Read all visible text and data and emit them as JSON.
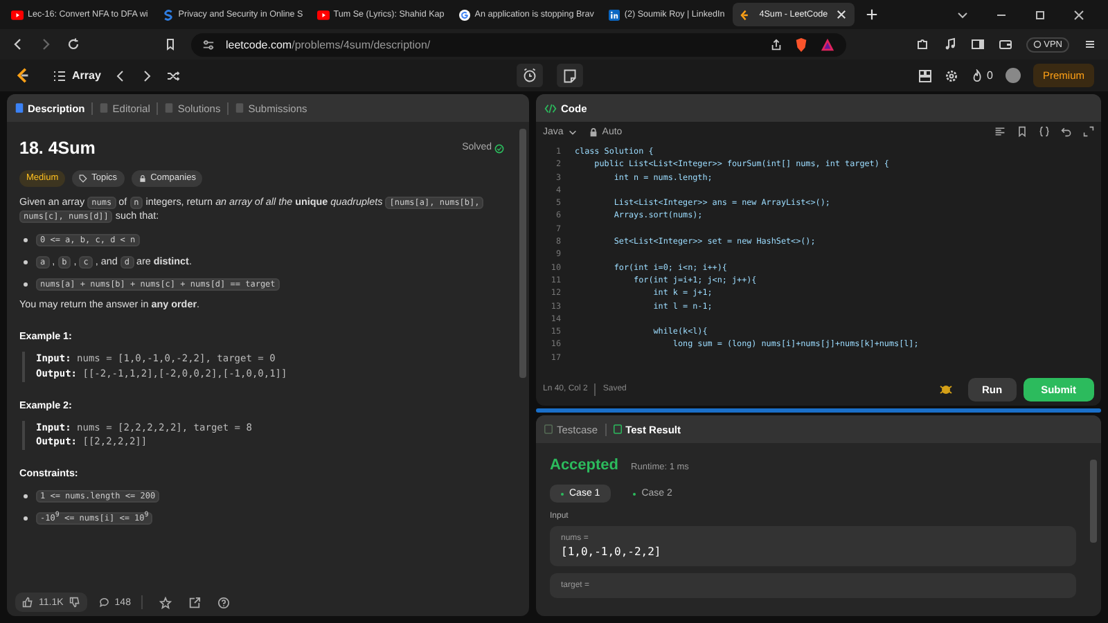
{
  "browser": {
    "tabs": [
      {
        "title": "Lec-16: Convert NFA to DFA wi",
        "kind": "video",
        "selected": false
      },
      {
        "title": "Privacy and Security in Online S",
        "kind": "letter",
        "selected": false
      },
      {
        "title": "Tum Se (Lyrics): Shahid Kap",
        "kind": "video",
        "selected": false
      },
      {
        "title": "An application is stopping Brav",
        "kind": "globe",
        "selected": false
      },
      {
        "title": "(2) Soumik Roy | LinkedIn",
        "kind": "square",
        "selected": false
      },
      {
        "title": "4Sum - LeetCode",
        "kind": "brand",
        "selected": true
      }
    ],
    "address": {
      "host": "leetcode.com",
      "path": "/problems/4sum/description/"
    },
    "vpn": "VPN"
  },
  "navbar": {
    "problem_list": "Array",
    "streak": "0",
    "premium": "Premium"
  },
  "description": {
    "tabs": [
      {
        "label": "Description",
        "selected": true
      },
      {
        "label": "Editorial",
        "selected": false
      },
      {
        "label": "Solutions",
        "selected": false
      },
      {
        "label": "Submissions",
        "selected": false
      }
    ],
    "title": "18. 4Sum",
    "status": "Solved",
    "tags": [
      {
        "label": "Medium",
        "kind": "difficulty"
      },
      {
        "label": "Topics",
        "kind": "topics"
      },
      {
        "label": "Companies",
        "kind": "companies"
      }
    ],
    "blocks": [
      {
        "kind": "paragraph",
        "segments": [
          {
            "kind": "text",
            "text": "Given an array"
          },
          {
            "kind": "code",
            "text": "nums"
          },
          {
            "kind": "text",
            "text": "of"
          },
          {
            "kind": "code",
            "text": "n"
          },
          {
            "kind": "text",
            "text": "integers, return *an array of all the* **unique** *quadruplets*"
          },
          {
            "kind": "code",
            "text": "[nums[a], nums[b],"
          },
          {
            "kind": "code",
            "text": "nums[c], nums[d]]"
          },
          {
            "kind": "text",
            "text": "such that:"
          }
        ]
      },
      {
        "kind": "bullet",
        "segments": [
          {
            "kind": "code",
            "text": "0 <= a, b, c, d < n"
          }
        ]
      },
      {
        "kind": "bullet",
        "segments": [
          {
            "kind": "code",
            "text": "a"
          },
          {
            "kind": "text",
            "text": ","
          },
          {
            "kind": "code",
            "text": "b"
          },
          {
            "kind": "text",
            "text": ","
          },
          {
            "kind": "code",
            "text": "c"
          },
          {
            "kind": "text",
            "text": ", and"
          },
          {
            "kind": "code",
            "text": "d"
          },
          {
            "kind": "text",
            "text": "are **distinct**."
          }
        ]
      },
      {
        "kind": "bullet",
        "segments": [
          {
            "kind": "code",
            "text": "nums[a] + nums[b] + nums[c] + nums[d] == target"
          }
        ]
      },
      {
        "kind": "paragraph",
        "segments": [
          {
            "kind": "text",
            "text": "You may return the answer in **any order**."
          }
        ]
      },
      {
        "kind": "heading",
        "text": "Example 1:"
      },
      {
        "kind": "example",
        "lines": [
          {
            "label": "Input:",
            "value": "nums = [1,0,-1,0,-2,2], target = 0"
          },
          {
            "label": "Output:",
            "value": "[[-2,-1,1,2],[-2,0,0,2],[-1,0,0,1]]"
          }
        ]
      },
      {
        "kind": "heading",
        "text": "Example 2:"
      },
      {
        "kind": "example",
        "lines": [
          {
            "label": "Input:",
            "value": "nums = [2,2,2,2,2], target = 8"
          },
          {
            "label": "Output:",
            "value": "[[2,2,2,2]]"
          }
        ]
      },
      {
        "kind": "heading",
        "text": "Constraints:"
      },
      {
        "kind": "bullet",
        "segments": [
          {
            "kind": "code",
            "text": "1 <= nums.length <= 200"
          }
        ]
      },
      {
        "kind": "bullet",
        "segments": [
          {
            "kind": "code",
            "text": "-10$^{9}$ <= nums[i] <= 10$^{9}$"
          }
        ]
      }
    ],
    "likes": "11.1K",
    "comments": "148"
  },
  "editor": {
    "title": "Code",
    "language": "Java",
    "mode": "Auto",
    "lines": [
      {
        "n": "1",
        "code": "class Solution {"
      },
      {
        "n": "2",
        "code": "    public List<List<Integer>> fourSum(int[] nums, int target) {"
      },
      {
        "n": "3",
        "code": "        int n = nums.length;"
      },
      {
        "n": "4"
      },
      {
        "n": "5",
        "code": "        List<List<Integer>> ans = new ArrayList<>();"
      },
      {
        "n": "6",
        "code": "        Arrays.sort(nums);"
      },
      {
        "n": "7"
      },
      {
        "n": "8",
        "code": "        Set<List<Integer>> set = new HashSet<>();"
      },
      {
        "n": "9"
      },
      {
        "n": "10",
        "code": "        for(int i=0; i<n; i++){"
      },
      {
        "n": "11",
        "code": "            for(int j=i+1; j<n; j++){"
      },
      {
        "n": "12",
        "code": "                int k = j+1;"
      },
      {
        "n": "13",
        "code": "                int l = n-1;"
      },
      {
        "n": "14"
      },
      {
        "n": "15",
        "code": "                while(k<l){"
      },
      {
        "n": "16",
        "code": "                    long sum = (long) nums[i]+nums[j]+nums[k]+nums[l];"
      },
      {
        "n": "17"
      }
    ],
    "cursor": "Ln 40, Col 2",
    "save_state": "Saved",
    "run": "Run",
    "submit": "Submit"
  },
  "results": {
    "tabs": [
      {
        "label": "Testcase",
        "selected": false
      },
      {
        "label": "Test Result",
        "selected": true
      }
    ],
    "verdict": "Accepted",
    "runtime": "Runtime: 1 ms",
    "cases": [
      {
        "label": "Case 1",
        "selected": true
      },
      {
        "label": "Case 2",
        "selected": false
      }
    ],
    "input_label": "Input",
    "inputs": [
      {
        "name": "nums =",
        "value": "[1,0,-1,0,-2,2]"
      },
      {
        "name": "target ="
      }
    ]
  }
}
